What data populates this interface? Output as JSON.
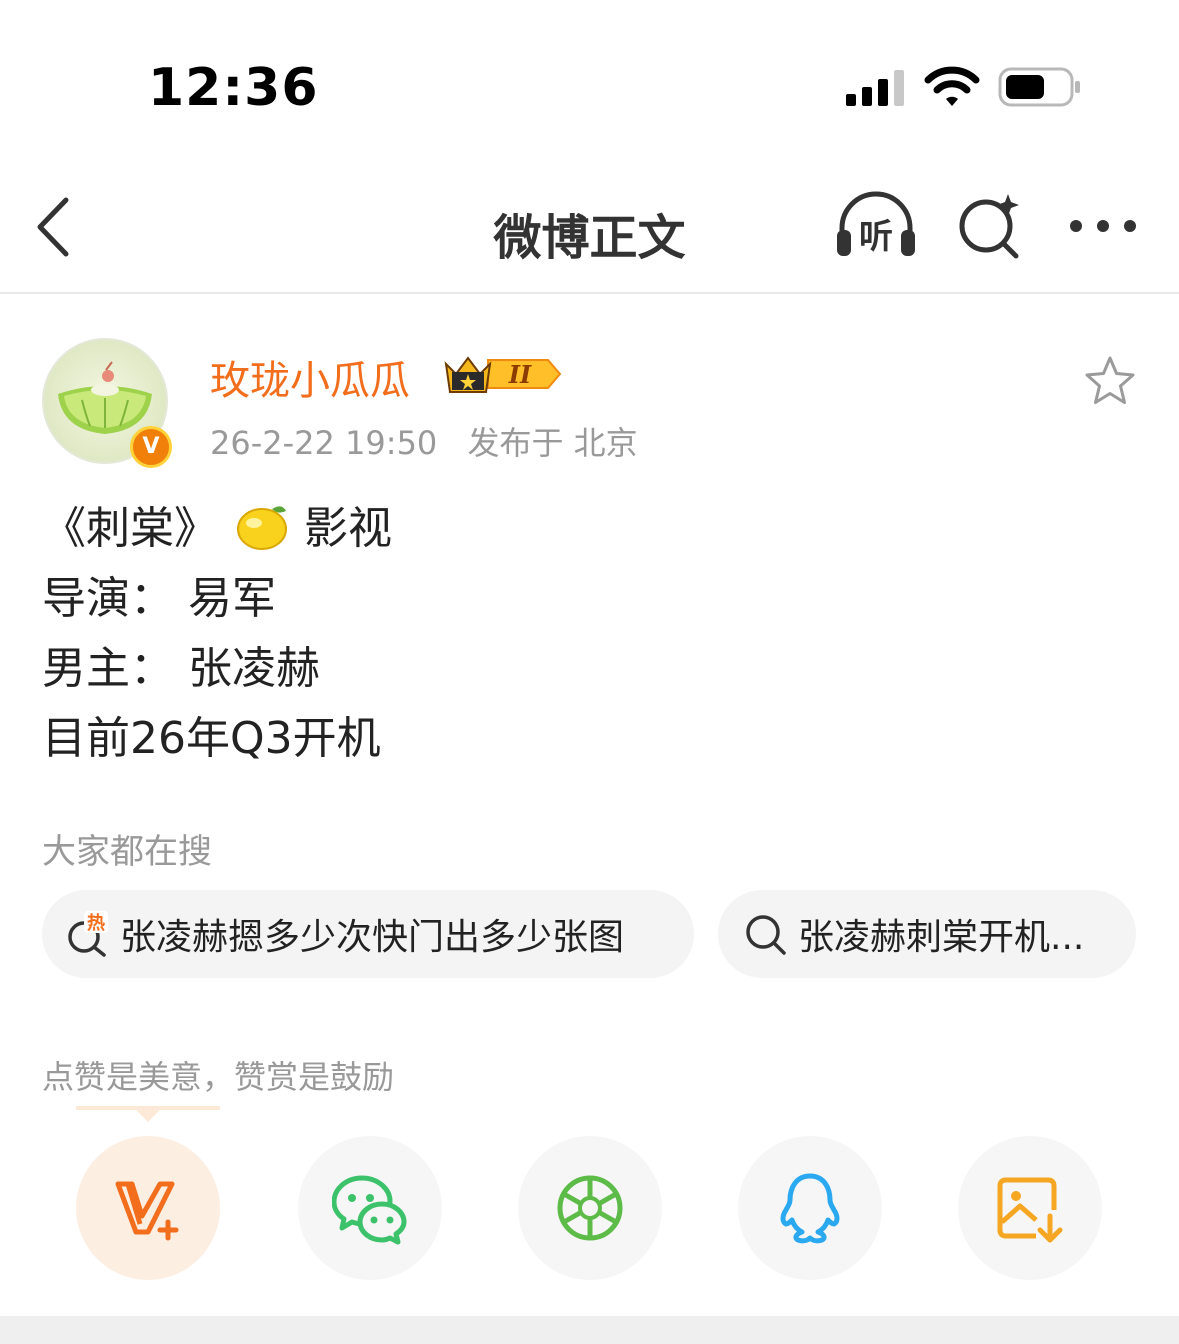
{
  "status_bar": {
    "time": "12:36"
  },
  "nav": {
    "title": "微博正文",
    "listen_label": "听"
  },
  "post": {
    "author": "玫珑小瓜瓜",
    "vip_level": "II",
    "verified_mark": "V",
    "date": "26-2-22 19:50",
    "location": "发布于 北京",
    "lines": {
      "title_open": "《刺棠》",
      "title_after": "影视",
      "director": "导演： 易军",
      "lead": "男主： 张凌赫",
      "status": "目前26年Q3开机"
    }
  },
  "search": {
    "label": "大家都在搜",
    "hot_badge": "热",
    "chips": [
      "张凌赫摁多少次快门出多少张图",
      "张凌赫刺棠开机..."
    ]
  },
  "reward": {
    "label": "点赞是美意，赞赏是鼓励"
  },
  "share_icons": [
    "v-plus-icon",
    "wechat-icon",
    "moments-icon",
    "qq-icon",
    "save-image-icon"
  ],
  "colors": {
    "accent": "#f26d1c",
    "wechat": "#3cc26a",
    "moments": "#5dbb48",
    "qq": "#2ba9f0",
    "save": "#f5a623"
  }
}
